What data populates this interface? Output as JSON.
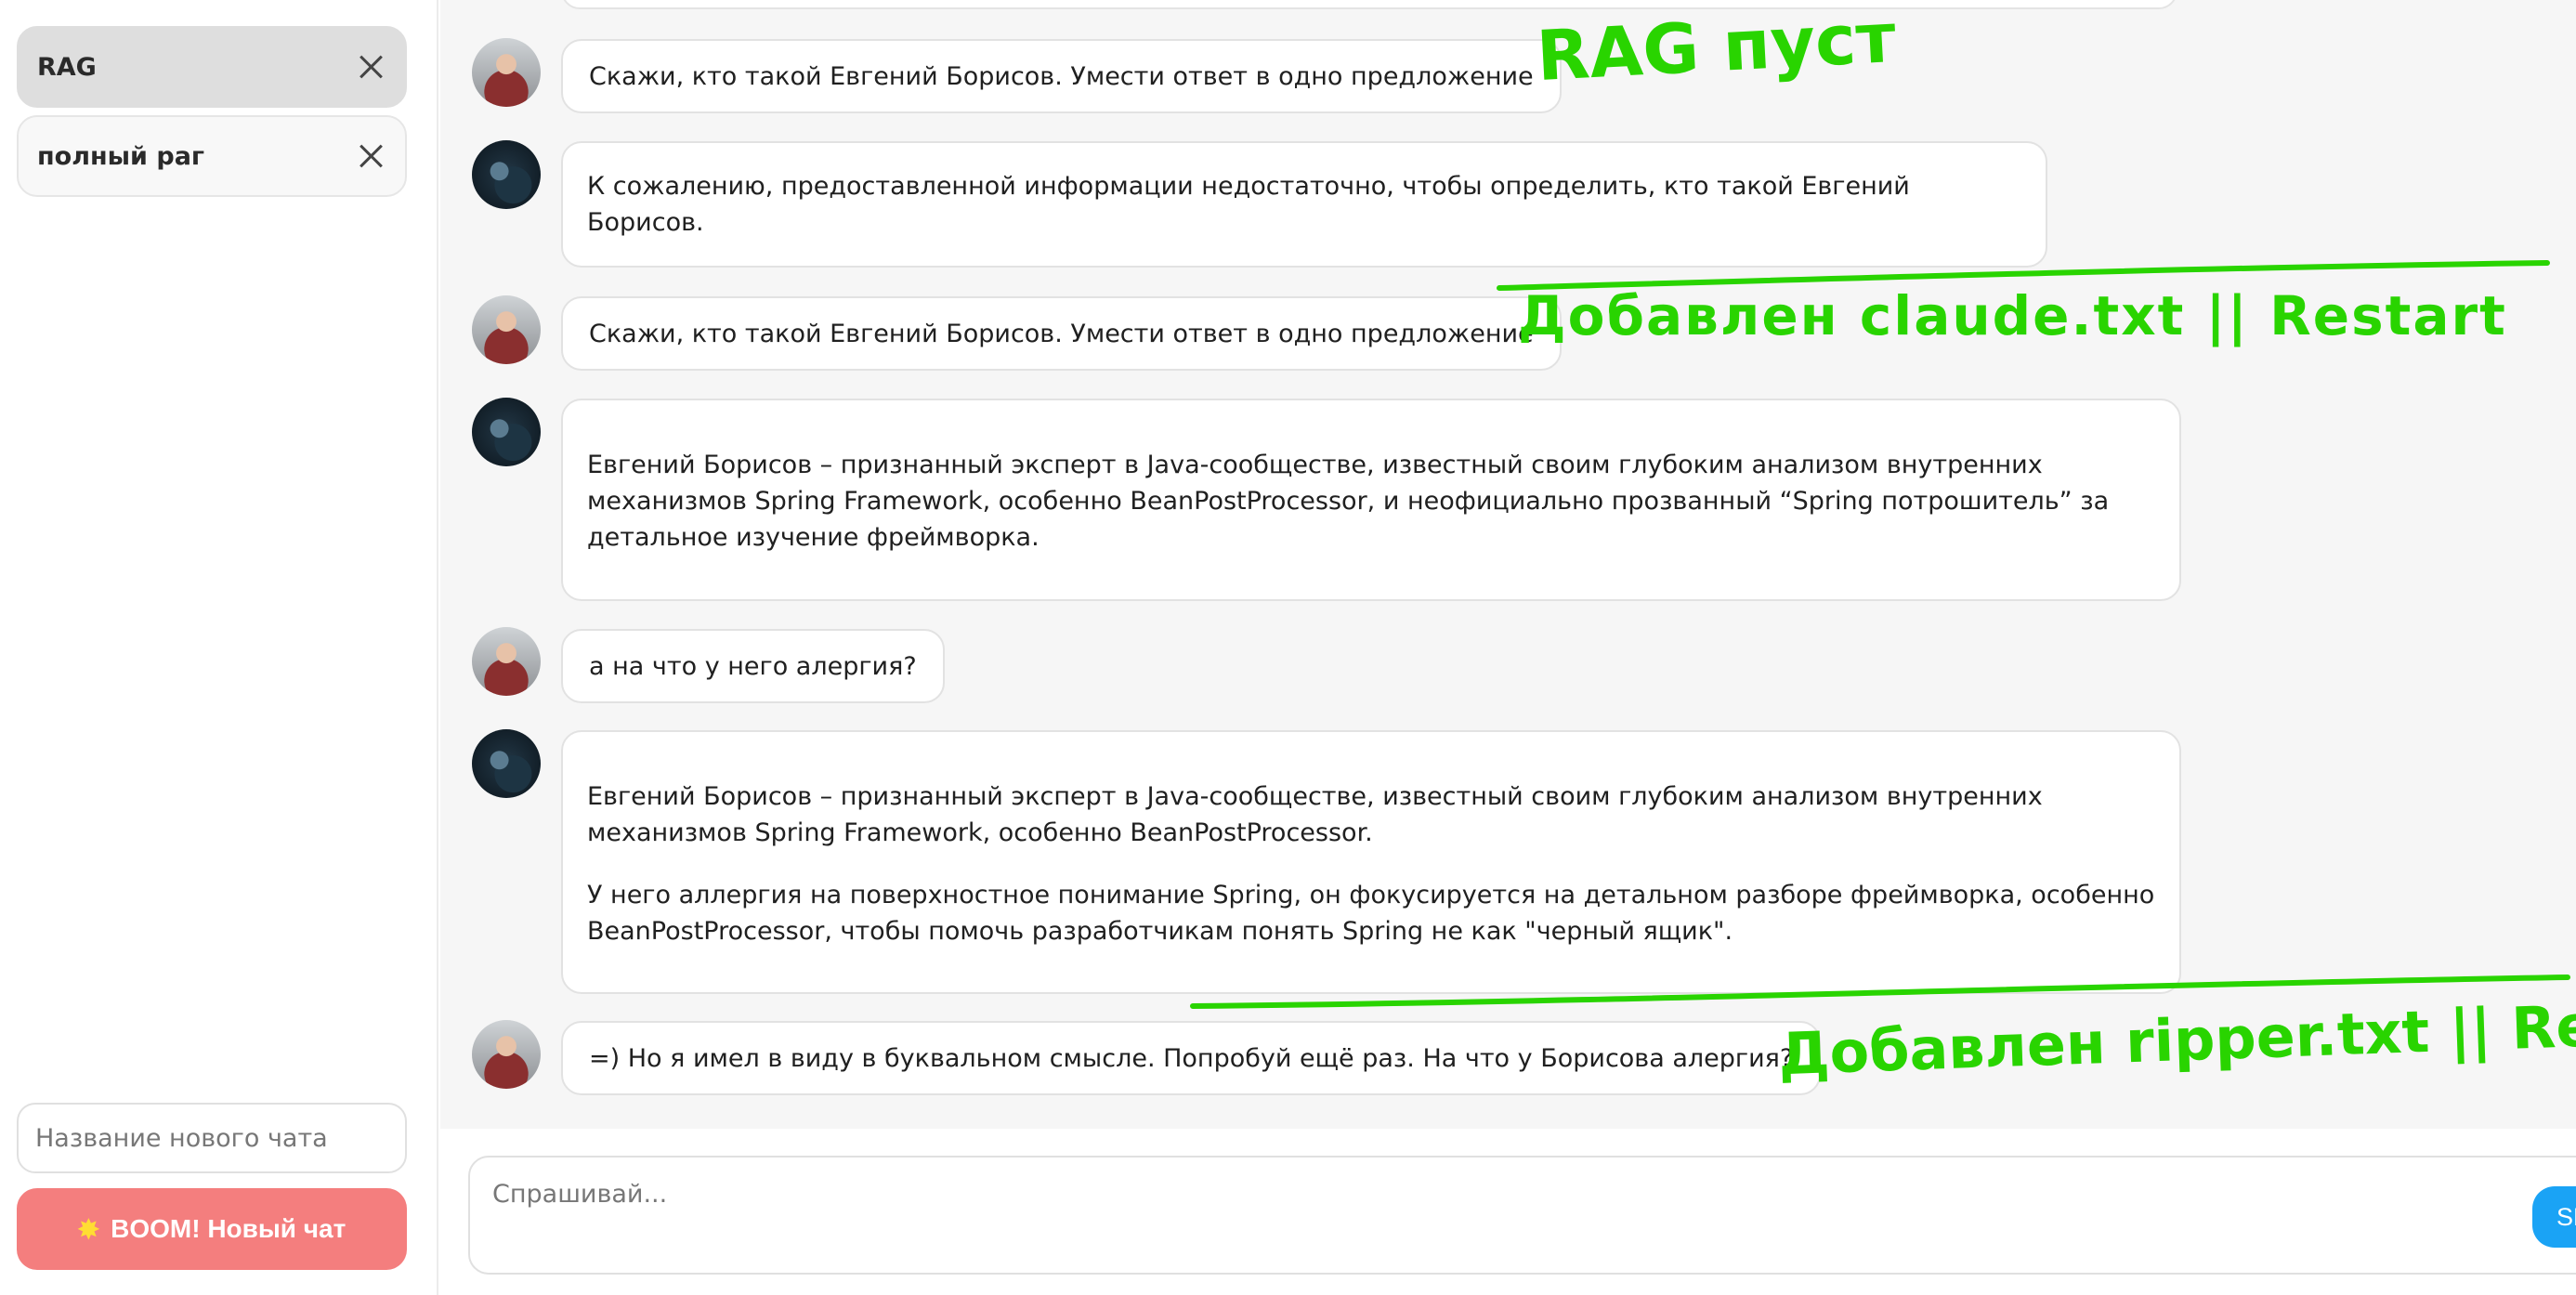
{
  "sidebar": {
    "chats": [
      {
        "label": "RAG",
        "active": true,
        "close_icon": "close-icon"
      },
      {
        "label": "полный раг",
        "active": false,
        "close_icon": "close-icon"
      }
    ],
    "new_chat_placeholder": "Название нового чата",
    "boom_icon": "collision-burst-icon",
    "boom_label": "BOOM! Новый чат"
  },
  "messages": [
    {
      "role": "user",
      "text": "Скажи, кто такой Евгений Борисов. Умести ответ в одно предложение"
    },
    {
      "role": "assistant",
      "paragraphs": [
        "К сожалению, предоставленной информации недостаточно, чтобы определить, кто такой Евгений Борисов."
      ]
    },
    {
      "role": "user",
      "text": "Скажи, кто такой Евгений Борисов. Умести ответ в одно предложение"
    },
    {
      "role": "assistant",
      "paragraphs": [
        "Евгений Борисов – признанный эксперт в Java-сообществе, известный своим глубоким анализом внутренних механизмов Spring Framework, особенно BeanPostProcessor, и неофициально прозванный “Spring потрошитель” за детальное изучение фреймворка."
      ]
    },
    {
      "role": "user",
      "text": "а на что у него алергия?"
    },
    {
      "role": "assistant",
      "paragraphs": [
        "Евгений Борисов – признанный эксперт в Java-сообществе, известный своим глубоким анализом внутренних механизмов Spring Framework, особенно BeanPostProcessor.",
        "У него аллергия на поверхностное понимание Spring, он фокусируется на детальном разборе фреймворка, особенно BeanPostProcessor, чтобы помочь разработчикам понять Spring не как \"черный ящик\"."
      ]
    },
    {
      "role": "user",
      "text": "=) Но я имел в виду в буквальном смысле. Попробуй ещё раз. На что у Борисова алергия?"
    }
  ],
  "annotations": [
    "RAG пуст",
    "Добавлен claude.txt || Restart",
    "Добавлен ripper.txt || Restart"
  ],
  "composer": {
    "placeholder": "Спрашивай...",
    "send_label": "SEND"
  },
  "colors": {
    "annotation": "#29d400",
    "boom_button": "#f47e7e",
    "send_button": "#1aa3f5",
    "active_chat": "#dedede"
  }
}
